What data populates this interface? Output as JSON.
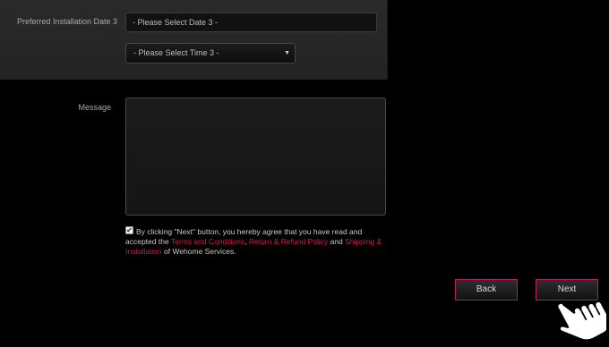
{
  "form": {
    "date3_label": "Preferred Installation Date 3",
    "date3_placeholder": "- Please Select Date 3 -",
    "time3_selected": "- Please Select Time 3 -",
    "message_label": "Message"
  },
  "agreement": {
    "checked": true,
    "text_prefix": "By clicking \"Next\" button, you hereby agree that you have read and accepted the ",
    "terms_link": "Terms and Conditions",
    "sep1": ", ",
    "refund_link": "Return & Refund Policy",
    "sep2": " and ",
    "shipping_link": "Shipping & Installation",
    "text_suffix": " of Wehome Services."
  },
  "buttons": {
    "back_label": "Back",
    "next_label": "Next"
  },
  "icons": {
    "dropdown": "chevron-down-icon",
    "checkbox": "checkmark-icon",
    "cursor": "hand-pointer-cursor-icon"
  },
  "colors": {
    "accent": "#c0186a",
    "link": "#d4145a",
    "background": "#000000",
    "panel": "#262626"
  }
}
